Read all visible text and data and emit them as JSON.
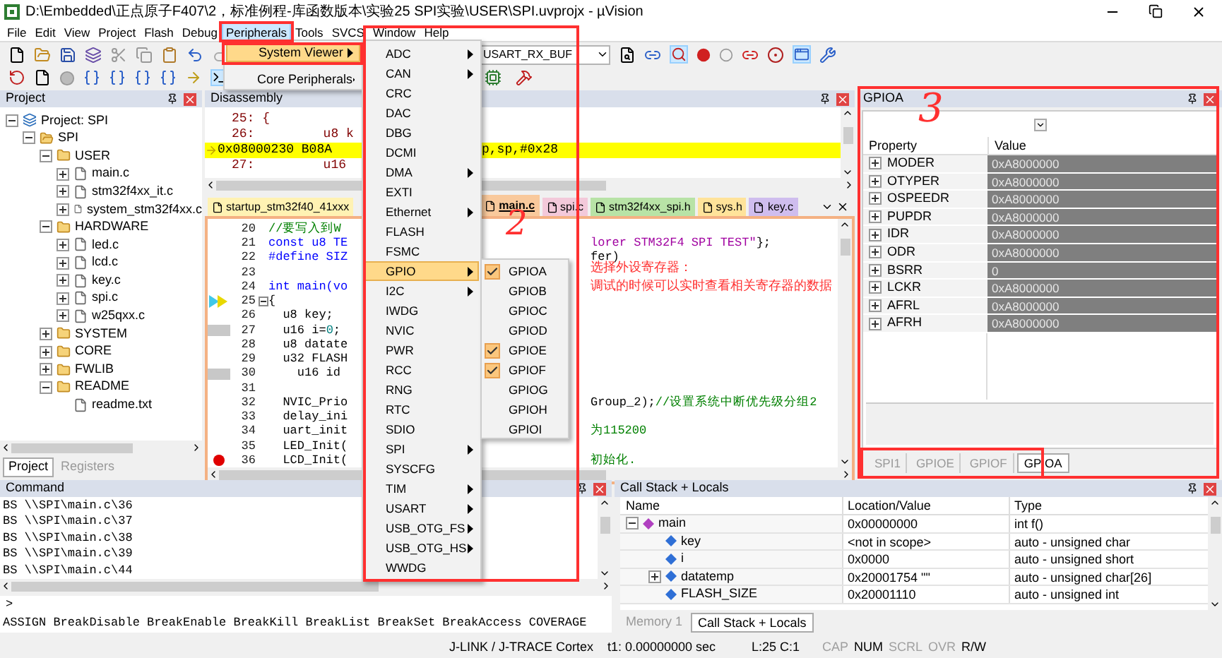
{
  "window": {
    "title": "D:\\Embedded\\正点原子F407\\2，标准例程-库函数版本\\实验25 SPI实验\\USER\\SPI.uvprojx - µVision"
  },
  "menu": [
    {
      "label": "File",
      "selected": false
    },
    {
      "label": "Edit",
      "selected": false
    },
    {
      "label": "View",
      "selected": false
    },
    {
      "label": "Project",
      "selected": false
    },
    {
      "label": "Flash",
      "selected": false
    },
    {
      "label": "Debug",
      "selected": false
    },
    {
      "label": "Peripherals",
      "selected": true
    },
    {
      "label": "Tools",
      "selected": false
    },
    {
      "label": "SVCS",
      "selected": false
    },
    {
      "label": "Window",
      "selected": false
    },
    {
      "label": "Help",
      "selected": false
    }
  ],
  "peripherals_menu": [
    {
      "label": "System Viewer",
      "selected": true,
      "has_submenu": true
    },
    {
      "label": "Core Peripherals",
      "selected": false,
      "has_submenu": true
    }
  ],
  "system_viewer_menu": [
    {
      "label": "ADC",
      "selected": false,
      "has_submenu": true
    },
    {
      "label": "CAN",
      "selected": false,
      "has_submenu": true
    },
    {
      "label": "CRC",
      "selected": false,
      "has_submenu": false
    },
    {
      "label": "DAC",
      "selected": false,
      "has_submenu": false
    },
    {
      "label": "DBG",
      "selected": false,
      "has_submenu": false
    },
    {
      "label": "DCMI",
      "selected": false,
      "has_submenu": false
    },
    {
      "label": "DMA",
      "selected": false,
      "has_submenu": true
    },
    {
      "label": "EXTI",
      "selected": false,
      "has_submenu": false
    },
    {
      "label": "Ethernet",
      "selected": false,
      "has_submenu": true
    },
    {
      "label": "FLASH",
      "selected": false,
      "has_submenu": false
    },
    {
      "label": "FSMC",
      "selected": false,
      "has_submenu": false
    },
    {
      "label": "GPIO",
      "selected": true,
      "has_submenu": true
    },
    {
      "label": "I2C",
      "selected": false,
      "has_submenu": true
    },
    {
      "label": "IWDG",
      "selected": false,
      "has_submenu": false
    },
    {
      "label": "NVIC",
      "selected": false,
      "has_submenu": false
    },
    {
      "label": "PWR",
      "selected": false,
      "has_submenu": false
    },
    {
      "label": "RCC",
      "selected": false,
      "has_submenu": false
    },
    {
      "label": "RNG",
      "selected": false,
      "has_submenu": false
    },
    {
      "label": "RTC",
      "selected": false,
      "has_submenu": false
    },
    {
      "label": "SDIO",
      "selected": false,
      "has_submenu": false
    },
    {
      "label": "SPI",
      "selected": false,
      "has_submenu": true
    },
    {
      "label": "SYSCFG",
      "selected": false,
      "has_submenu": false
    },
    {
      "label": "TIM",
      "selected": false,
      "has_submenu": true
    },
    {
      "label": "USART",
      "selected": false,
      "has_submenu": true
    },
    {
      "label": "USB_OTG_FS",
      "selected": false,
      "has_submenu": true
    },
    {
      "label": "USB_OTG_HS",
      "selected": false,
      "has_submenu": true
    },
    {
      "label": "WWDG",
      "selected": false,
      "has_submenu": false
    }
  ],
  "gpio_menu": [
    {
      "label": "GPIOA",
      "checked": true
    },
    {
      "label": "GPIOB",
      "checked": false
    },
    {
      "label": "GPIOC",
      "checked": false
    },
    {
      "label": "GPIOD",
      "checked": false
    },
    {
      "label": "GPIOE",
      "checked": true
    },
    {
      "label": "GPIOF",
      "checked": true
    },
    {
      "label": "GPIOG",
      "checked": false
    },
    {
      "label": "GPIOH",
      "checked": false
    },
    {
      "label": "GPIOI",
      "checked": false
    }
  ],
  "toolbar": {
    "symbol_field": {
      "value": "USART_RX_BUF"
    }
  },
  "project": {
    "title": "Project",
    "tree": [
      {
        "label": "Project: SPI",
        "kind": "project",
        "expanded": true,
        "children": [
          {
            "label": "SPI",
            "kind": "target",
            "expanded": true,
            "children": [
              {
                "label": "USER",
                "kind": "folder",
                "expanded": true,
                "children": [
                  {
                    "label": "main.c",
                    "kind": "file",
                    "expanded": false
                  },
                  {
                    "label": "stm32f4xx_it.c",
                    "kind": "file",
                    "expanded": false
                  },
                  {
                    "label": "system_stm32f4xx.c",
                    "kind": "file",
                    "expanded": false
                  }
                ]
              },
              {
                "label": "HARDWARE",
                "kind": "folder",
                "expanded": true,
                "children": [
                  {
                    "label": "led.c",
                    "kind": "file",
                    "expanded": false
                  },
                  {
                    "label": "lcd.c",
                    "kind": "file",
                    "expanded": false
                  },
                  {
                    "label": "key.c",
                    "kind": "file",
                    "expanded": false
                  },
                  {
                    "label": "spi.c",
                    "kind": "file",
                    "expanded": false
                  },
                  {
                    "label": "w25qxx.c",
                    "kind": "file",
                    "expanded": false
                  }
                ]
              },
              {
                "label": "SYSTEM",
                "kind": "folder",
                "expanded": false
              },
              {
                "label": "CORE",
                "kind": "folder",
                "expanded": false
              },
              {
                "label": "FWLIB",
                "kind": "folder",
                "expanded": false
              },
              {
                "label": "README",
                "kind": "folder",
                "expanded": true,
                "children": [
                  {
                    "label": "readme.txt",
                    "kind": "file"
                  }
                ]
              }
            ]
          }
        ]
      }
    ],
    "tabs": [
      {
        "label": "Project",
        "selected": true
      },
      {
        "label": "Registers",
        "selected": false
      }
    ]
  },
  "disassembly": {
    "title": "Disassembly",
    "lines": [
      {
        "text": "25: {",
        "current": false
      },
      {
        "text": "26:         u8 k",
        "current": false
      },
      {
        "text": "0x08000230 B08A",
        "tail": "p,sp,#0x28",
        "current": true
      },
      {
        "text": "27:         u16",
        "current": false
      }
    ]
  },
  "editor": {
    "tabs": [
      {
        "label": "startup_stm32f40_41xxx",
        "selected": false,
        "color": "#fff2b3"
      },
      {
        "label": "main.c",
        "selected": true,
        "color": "#f9c99c"
      },
      {
        "label": "spi.c",
        "selected": false,
        "color": "#f3c9da"
      },
      {
        "label": "stm32f4xx_spi.h",
        "selected": false,
        "color": "#b8e3a6"
      },
      {
        "label": "sys.h",
        "selected": false,
        "color": "#ffe39a"
      },
      {
        "label": "key.c",
        "selected": false,
        "color": "#cfbdee"
      }
    ],
    "lines": [
      {
        "number": "20",
        "kind": "plain",
        "fold": false,
        "code": [
          {
            "text": "//要写入到W",
            "kind": "comment"
          }
        ]
      },
      {
        "number": "21",
        "kind": "plain",
        "fold": false,
        "code": [
          {
            "text": "const u8 TE",
            "kind": "keyword"
          }
        ],
        "tail": [
          {
            "text": "lorer STM32F4 SPI TEST\"",
            "kind": "string"
          },
          {
            "text": "};",
            "kind": "plain"
          }
        ]
      },
      {
        "number": "22",
        "kind": "plain",
        "fold": false,
        "code": [
          {
            "text": "#define SIZ",
            "kind": "keyword"
          }
        ],
        "tail": [
          {
            "text": "fer)",
            "kind": "plain"
          }
        ]
      },
      {
        "number": "23",
        "kind": "plain",
        "fold": false
      },
      {
        "number": "24",
        "kind": "plain",
        "fold": false,
        "code": [
          {
            "text": "int main(vo",
            "kind": "keyword"
          }
        ]
      },
      {
        "number": "25",
        "kind": "current",
        "fold": true,
        "code": [
          {
            "text": "{",
            "kind": "plain"
          }
        ]
      },
      {
        "number": "26",
        "kind": "plain",
        "fold": false,
        "code": [
          {
            "text": "  u8 key;",
            "kind": "plain"
          }
        ]
      },
      {
        "number": "27",
        "kind": "executable",
        "fold": false,
        "code": [
          {
            "text": "  u16 i=",
            "kind": "plain"
          },
          {
            "text": "0",
            "kind": "number"
          },
          {
            "text": ";",
            "kind": "plain"
          }
        ]
      },
      {
        "number": "28",
        "kind": "plain",
        "fold": false,
        "code": [
          {
            "text": "  u8 datate",
            "kind": "plain"
          }
        ]
      },
      {
        "number": "29",
        "kind": "plain",
        "fold": false,
        "code": [
          {
            "text": "  u32 FLASH",
            "kind": "plain"
          }
        ]
      },
      {
        "number": "30",
        "kind": "executable",
        "fold": false,
        "code": [
          {
            "text": "    u16 id",
            "kind": "plain"
          }
        ]
      },
      {
        "number": "31",
        "kind": "plain",
        "fold": false
      },
      {
        "number": "32",
        "kind": "plain",
        "fold": false,
        "code": [
          {
            "text": "  NVIC_Prio",
            "kind": "plain"
          }
        ],
        "tail": [
          {
            "text": "Group_2);",
            "kind": "plain"
          },
          {
            "text": "//设置系统中断优先级分组2",
            "kind": "comment"
          }
        ]
      },
      {
        "number": "33",
        "kind": "plain",
        "fold": false,
        "code": [
          {
            "text": "  delay_ini",
            "kind": "plain"
          }
        ]
      },
      {
        "number": "34",
        "kind": "plain",
        "fold": false,
        "code": [
          {
            "text": "  uart_init",
            "kind": "plain"
          }
        ],
        "tail": [
          {
            "text": "为115200",
            "kind": "comment"
          }
        ]
      },
      {
        "number": "35",
        "kind": "plain",
        "fold": false,
        "code": [
          {
            "text": "  LED_Init(",
            "kind": "plain"
          }
        ]
      },
      {
        "number": "36",
        "kind": "breakpoint",
        "fold": false,
        "code": [
          {
            "text": "  LCD_Init(",
            "kind": "plain"
          }
        ],
        "tail": [
          {
            "text": "初始化.",
            "kind": "comment"
          }
        ]
      }
    ]
  },
  "peripheral": {
    "title": "GPIOA",
    "columns": [
      "Property",
      "Value"
    ],
    "rows": [
      {
        "name": "MODER",
        "value": "0xA8000000",
        "expanded": false
      },
      {
        "name": "OTYPER",
        "value": "0xA8000000",
        "expanded": false
      },
      {
        "name": "OSPEEDR",
        "value": "0xA8000000",
        "expanded": false
      },
      {
        "name": "PUPDR",
        "value": "0xA8000000",
        "expanded": false
      },
      {
        "name": "IDR",
        "value": "0xA8000000",
        "expanded": false
      },
      {
        "name": "ODR",
        "value": "0xA8000000",
        "expanded": false
      },
      {
        "name": "BSRR",
        "value": "0",
        "expanded": false
      },
      {
        "name": "LCKR",
        "value": "0xA8000000",
        "expanded": false
      },
      {
        "name": "AFRL",
        "value": "0xA8000000",
        "expanded": false
      },
      {
        "name": "AFRH",
        "value": "0xA8000000",
        "expanded": false
      }
    ],
    "tabs": [
      {
        "label": "SPI1",
        "selected": false
      },
      {
        "label": "GPIOE",
        "selected": false
      },
      {
        "label": "GPIOF",
        "selected": false
      },
      {
        "label": "GPIOA",
        "selected": true
      }
    ]
  },
  "command": {
    "title": "Command",
    "lines": [
      "BS \\\\SPI\\main.c\\36",
      "BS \\\\SPI\\main.c\\37",
      "BS \\\\SPI\\main.c\\38",
      "BS \\\\SPI\\main.c\\39",
      "BS \\\\SPI\\main.c\\44"
    ],
    "prompt": ">",
    "help": "ASSIGN BreakDisable BreakEnable BreakKill BreakList BreakSet BreakAccess COVERAGE"
  },
  "callstack": {
    "title": "Call Stack + Locals",
    "columns": [
      "Name",
      "Location/Value",
      "Type"
    ],
    "rows": [
      {
        "name": "main",
        "value": "0x00000000",
        "type": "int f()",
        "kind": "function",
        "expanded": true,
        "children": [
          {
            "name": "key",
            "value": "<not in scope>",
            "type": "auto - unsigned char",
            "kind": "variable"
          },
          {
            "name": "i",
            "value": "0x0000",
            "type": "auto - unsigned short",
            "kind": "variable"
          },
          {
            "name": "datatemp",
            "value": "0x20001754 \"\"",
            "type": "auto - unsigned char[26]",
            "kind": "variable",
            "expanded": false
          },
          {
            "name": "FLASH_SIZE",
            "value": "0x20001110",
            "type": "auto - unsigned int",
            "kind": "variable"
          }
        ]
      }
    ],
    "tabs": [
      {
        "label": "Memory 1",
        "selected": false
      },
      {
        "label": "Call Stack + Locals",
        "selected": true
      }
    ]
  },
  "status_bar": {
    "items": [
      "J-LINK / J-TRACE Cortex",
      "t1: 0.00000000 sec",
      "L:25 C:1"
    ],
    "indicators": [
      {
        "label": "CAP",
        "on": false
      },
      {
        "label": "NUM",
        "on": true
      },
      {
        "label": "SCRL",
        "on": false
      },
      {
        "label": "OVR",
        "on": false
      },
      {
        "label": "R/W",
        "on": true
      }
    ]
  },
  "annotations": {
    "marks": [
      "2",
      "3"
    ],
    "note_lines": [
      "选择外设寄存器：",
      "调试的时候可以实时查看相关寄存器的数据"
    ]
  }
}
